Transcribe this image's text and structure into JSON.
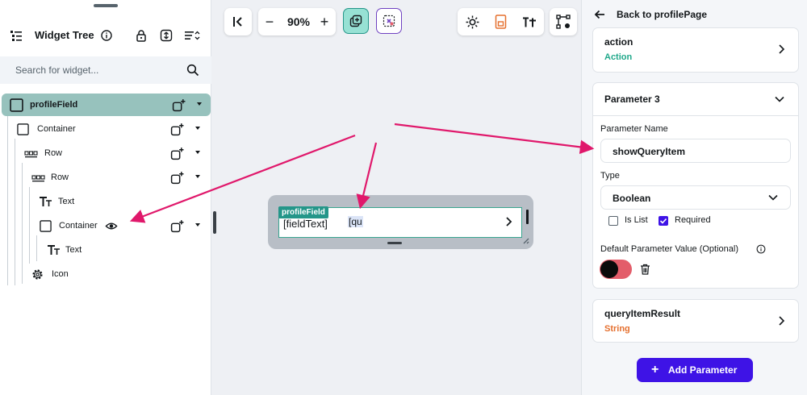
{
  "widget_tree": {
    "title": "Widget Tree",
    "search_placeholder": "Search for widget...",
    "items": [
      {
        "label": "profileField",
        "icon": "container-icon"
      },
      {
        "label": "Container",
        "icon": "container-icon"
      },
      {
        "label": "Row",
        "icon": "row-icon"
      },
      {
        "label": "Row",
        "icon": "row-icon"
      },
      {
        "label": "Text",
        "icon": "text-icon"
      },
      {
        "label": "Container",
        "icon": "container-icon"
      },
      {
        "label": "Text",
        "icon": "text-icon"
      },
      {
        "label": "Icon",
        "icon": "gear-icon"
      }
    ]
  },
  "canvas": {
    "zoom": "90%",
    "zoom_minus": "−",
    "zoom_plus": "+",
    "field_tag": "profileField",
    "field_text": "[fieldText]",
    "field_query": "[qu"
  },
  "properties": {
    "back_label": "Back to profilePage",
    "action": {
      "title": "action",
      "subtitle": "Action"
    },
    "parameter": {
      "title": "Parameter 3",
      "name_label": "Parameter Name",
      "name_value": "showQueryItem",
      "type_label": "Type",
      "type_value": "Boolean",
      "is_list_label": "Is List",
      "required_label": "Required",
      "default_label": "Default Parameter Value (Optional)"
    },
    "query_item": {
      "title": "queryItemResult",
      "subtitle": "String"
    },
    "add_button": "Add Parameter"
  },
  "colors": {
    "selected_row": "#97c2bd",
    "teal": "#249689",
    "accent_purple": "#3e13e6",
    "action_green": "#1fa88a",
    "string_orange": "#e5702f",
    "switch_red": "#e35d6a",
    "arrow_pink": "#e0186b"
  }
}
